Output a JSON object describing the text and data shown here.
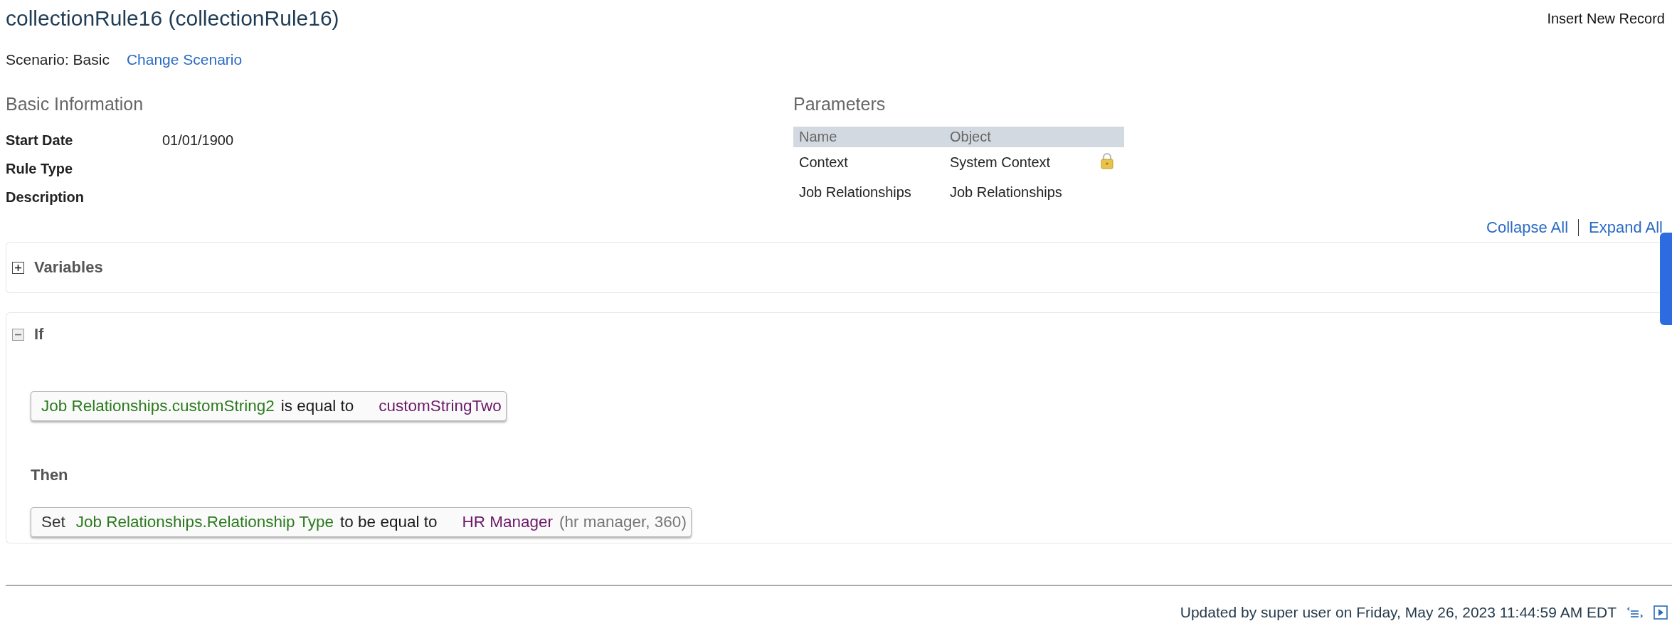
{
  "title": "collectionRule16 (collectionRule16)",
  "header_action": "Insert New Record",
  "scenario": {
    "label": "Scenario: Basic",
    "link": "Change Scenario"
  },
  "basic_information": {
    "heading": "Basic Information",
    "fields": [
      {
        "label": "Start Date",
        "value": "01/01/1900"
      },
      {
        "label": "Rule Type"
      },
      {
        "label": "Description"
      }
    ]
  },
  "parameters": {
    "heading": "Parameters",
    "columns": [
      "Name",
      "Object"
    ],
    "rows": [
      {
        "name": "Context",
        "object": "System Context",
        "locked": true
      },
      {
        "name": "Job Relationships",
        "object": "Job Relationships",
        "locked": false
      }
    ]
  },
  "tree_controls": [
    "Collapse All",
    "Expand All"
  ],
  "sections": [
    {
      "kind": "variables",
      "title": "Variables",
      "expanded": false
    },
    {
      "kind": "if",
      "title": "If",
      "expanded": true,
      "condition": [
        {
          "kind": "field",
          "text": "Job Relationships.customString2"
        },
        {
          "kind": "operator",
          "text": "is equal to"
        },
        {
          "kind": "value",
          "text": "customStringTwo"
        }
      ],
      "then_title": "Then",
      "action": [
        {
          "kind": "keyword",
          "text": "Set"
        },
        {
          "kind": "field",
          "text": "Job Relationships.Relationship Type"
        },
        {
          "kind": "operator",
          "text": "to be equal to"
        },
        {
          "kind": "value",
          "text": "HR Manager"
        },
        {
          "kind": "note",
          "text": "(hr manager, 360)"
        }
      ]
    }
  ],
  "footer": {
    "text": "Updated by super user on Friday, May 26, 2023 11:44:59 AM EDT"
  }
}
